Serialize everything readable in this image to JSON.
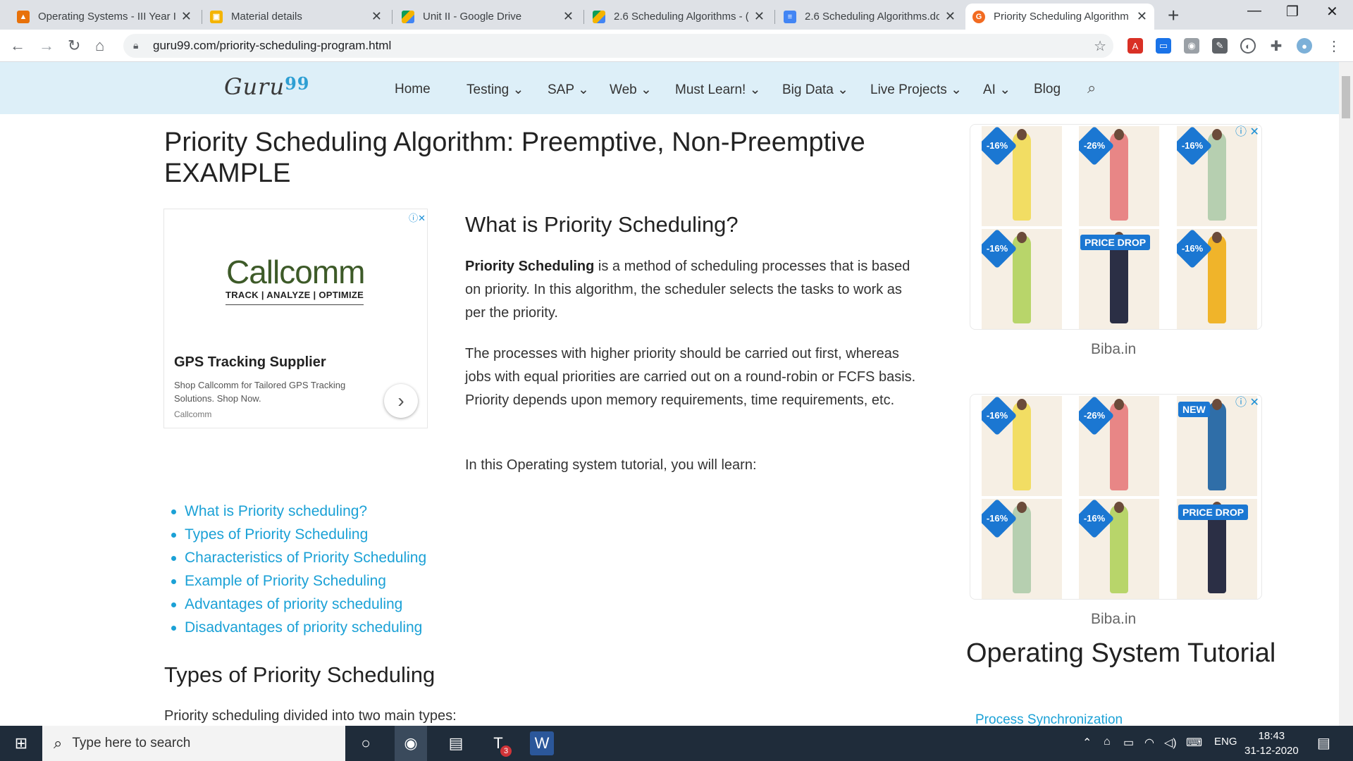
{
  "browser": {
    "tabs": [
      {
        "title": "Operating Systems - III Year I",
        "icon": "orange-doc-icon",
        "color": "#e8710a"
      },
      {
        "title": "Material details",
        "icon": "slides-icon",
        "color": "#f4b400"
      },
      {
        "title": "Unit II - Google Drive",
        "icon": "google-drive-icon",
        "color": "#1a73e8"
      },
      {
        "title": "2.6 Scheduling Algorithms - (",
        "icon": "google-drive-icon",
        "color": "#1a73e8"
      },
      {
        "title": "2.6 Scheduling Algorithms.do",
        "icon": "docs-icon",
        "color": "#4285f4"
      },
      {
        "title": "Priority Scheduling Algorithm",
        "icon": "guru99-icon",
        "color": "#f26b21"
      }
    ],
    "url": "guru99.com/priority-scheduling-program.html"
  },
  "site": {
    "logo_text": "Guru",
    "logo_num": "99",
    "nav": [
      "Home",
      "Testing",
      "SAP",
      "Web",
      "Must Learn!",
      "Big Data",
      "Live Projects",
      "AI",
      "Blog"
    ]
  },
  "article": {
    "title": "Priority Scheduling Algorithm: Preemptive, Non-Preemptive EXAMPLE",
    "section1_heading": "What is Priority Scheduling?",
    "p1_bold": "Priority Scheduling",
    "p1_rest": " is a method of scheduling processes that is based on priority. In this algorithm, the scheduler selects the tasks to work as per the priority.",
    "p2": "The processes with higher priority should be carried out first, whereas jobs with equal priorities are carried out on a round-robin or FCFS basis. Priority depends upon memory requirements, time requirements, etc.",
    "p3": "In this Operating system tutorial, you will learn:",
    "toc": [
      "What is Priority scheduling?",
      "Types of Priority Scheduling",
      "Characteristics of Priority Scheduling",
      "Example of Priority Scheduling",
      "Advantages of priority scheduling",
      "Disadvantages of priority scheduling"
    ],
    "section2_heading": "Types of Priority Scheduling",
    "p4": "Priority scheduling divided into two main types:"
  },
  "ad_left": {
    "brand": "Callcomm",
    "tagline": "TRACK | ANALYZE | OPTIMIZE",
    "title": "GPS Tracking Supplier",
    "desc": "Shop Callcomm for Tailored GPS Tracking Solutions. Shop Now.",
    "source": "Callcomm"
  },
  "ads_right": {
    "label": "Biba.in",
    "block1": [
      {
        "badge": "-16%",
        "color": "#f2dd63"
      },
      {
        "badge": "-26%",
        "color": "#e88686"
      },
      {
        "badge": "-16%",
        "color": "#b6cfb0"
      },
      {
        "badge": "-16%",
        "color": "#b8d56a"
      },
      {
        "badge": "PRICE DROP",
        "color": "#2b2f45"
      },
      {
        "badge": "-16%",
        "color": "#f0b42a"
      }
    ],
    "block2": [
      {
        "badge": "-16%",
        "color": "#f2dd63"
      },
      {
        "badge": "-26%",
        "color": "#e88686"
      },
      {
        "badge": "NEW",
        "color": "#2f6ea8"
      },
      {
        "badge": "-16%",
        "color": "#b6cfb0"
      },
      {
        "badge": "-16%",
        "color": "#b8d56a"
      },
      {
        "badge": "PRICE DROP",
        "color": "#2b2f45"
      }
    ]
  },
  "sidebar": {
    "heading": "Operating System Tutorial",
    "link": "Process Synchronization"
  },
  "taskbar": {
    "search_placeholder": "Type here to search",
    "teams_badge": "3",
    "lang": "ENG",
    "time": "18:43",
    "date": "31-12-2020"
  }
}
